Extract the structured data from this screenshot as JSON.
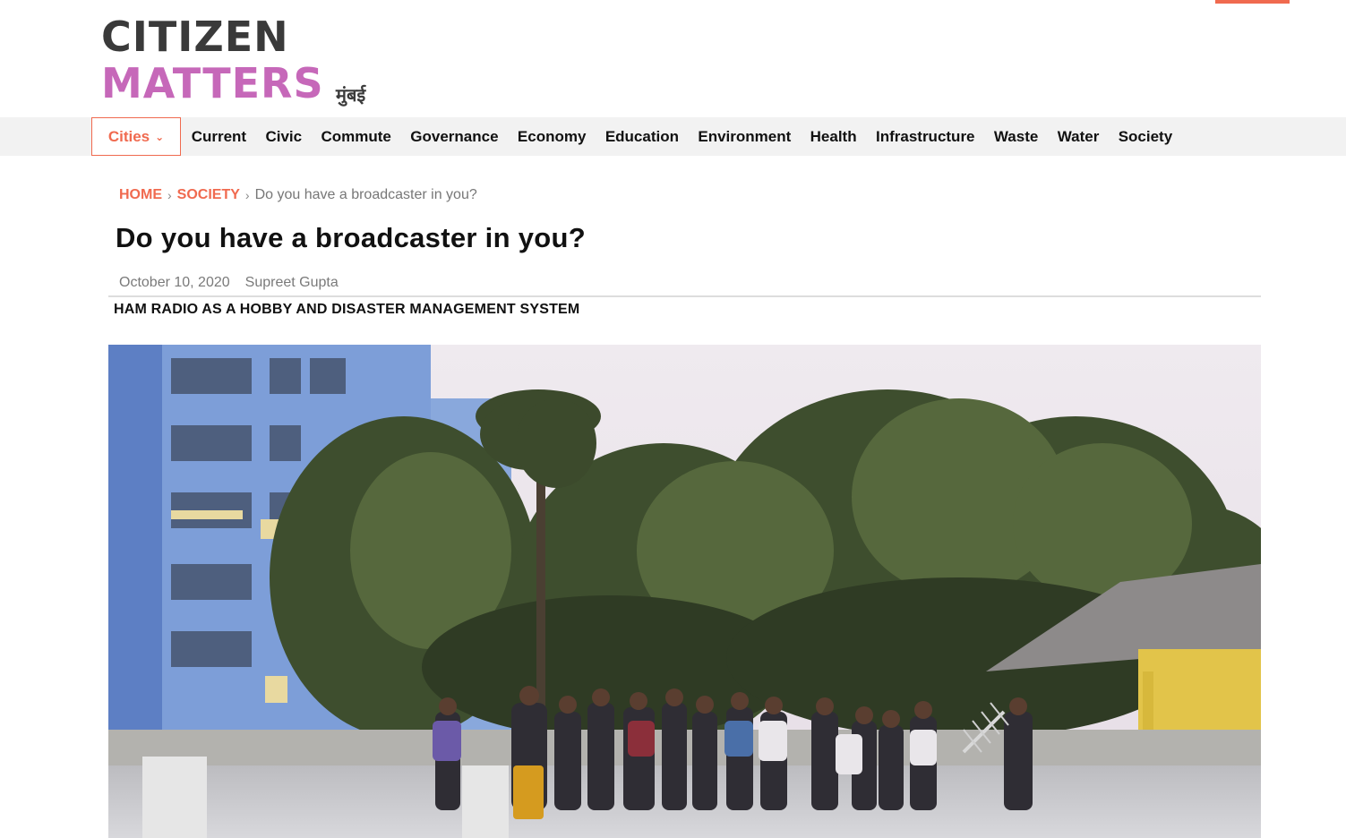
{
  "logo": {
    "line1": "CITIZEN",
    "line2": "MATTERS",
    "city": "मुंबई"
  },
  "nav": {
    "cities_label": "Cities",
    "items": [
      "Current",
      "Civic",
      "Commute",
      "Governance",
      "Economy",
      "Education",
      "Environment",
      "Health",
      "Infrastructure",
      "Waste",
      "Water",
      "Society"
    ]
  },
  "breadcrumb": {
    "home": "HOME",
    "section": "SOCIETY",
    "current": "Do you have a broadcaster in you?"
  },
  "article": {
    "title": "Do you have a broadcaster in you?",
    "date": "October 10, 2020",
    "author": "Supreet Gupta",
    "subtitle": "HAM RADIO AS A HOBBY AND DISASTER MANAGEMENT SYSTEM"
  },
  "colors": {
    "accent": "#f06a4f",
    "brand_pink": "#c668b9",
    "brand_dark": "#3a3a3a"
  }
}
